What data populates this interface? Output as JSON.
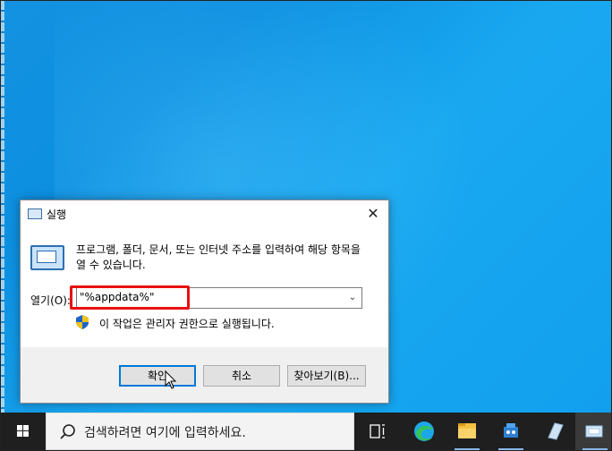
{
  "dialog": {
    "title": "실행",
    "close_symbol": "✕",
    "description": "프로그램, 폴더, 문서, 또는 인터넷 주소를 입력하여 해당 항목을 열 수 있습니다.",
    "open_label": "열기(O):",
    "open_value": "\"%appdata%\"",
    "admin_note": "이 작업은 관리자 권한으로 실행됩니다.",
    "ok_label": "확인",
    "cancel_label": "취소",
    "browse_label": "찾아보기(B)..."
  },
  "taskbar": {
    "search_placeholder": "검색하려면 여기에 입력하세요.",
    "icons": [
      "windows-start-icon",
      "search-icon",
      "task-view-icon",
      "edge-icon",
      "file-explorer-icon",
      "app-icon",
      "notes-icon",
      "run-icon"
    ]
  },
  "colors": {
    "desktop": "#1393e0",
    "highlight": "#e81010",
    "taskbar": "#1f1f1f",
    "primary_border": "#0078d7"
  }
}
